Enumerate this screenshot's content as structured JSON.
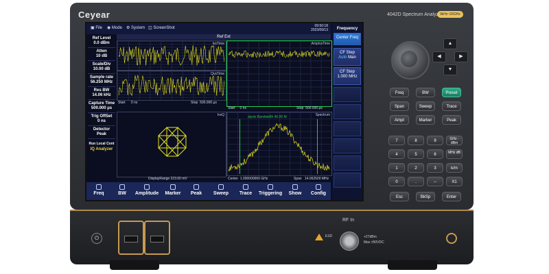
{
  "device": {
    "brand": "Ceyear",
    "model": "4042D Spectrum Analyzer",
    "model_badge": "9kHz~26GHz"
  },
  "menu": {
    "file": "File",
    "mode": "Mode",
    "system": "System",
    "screenshot": "ScreenShot",
    "time": "09:50:18",
    "date": "2023/09/13"
  },
  "params": {
    "ref_level_label": "Ref Level",
    "ref_level_value": "0.0 dBm",
    "atten_label": "Atten",
    "atten_value": "10 dB",
    "scale_label": "Scale/Div",
    "scale_value": "10.00 dB",
    "sample_rate_label": "Sample rate",
    "sample_rate_value": "56.250 MHz",
    "res_bw_label": "Res BW",
    "res_bw_value": "14.06 kHz",
    "capture_time_label": "Capture Time",
    "capture_time_value": "500.000 µs",
    "trig_offset_label": "Trig OffSet",
    "trig_offset_value": "0 ns",
    "detector_label": "Detector",
    "detector_value": "Peak",
    "run_local": "Run Local Cont",
    "mode_name": "IQ Analyzer"
  },
  "ref_ext": "Ref Ext",
  "charts": {
    "i_title": "IvsTime",
    "q_title": "QvsTime",
    "ampl_title": "AmplvsTime",
    "iq_title": "IvsQ",
    "spectrum_title": "Spectrum",
    "start_label": "Start",
    "start_value": "0 ns",
    "stop_label": "Stop",
    "stop_value": "500.000 µs",
    "start_label_2": "Start",
    "start_value_2": "0 ns",
    "stop_label_2": "Stop",
    "stop_value_2": "500.000 µs",
    "display_range": "DisplayRange 223.60 mV",
    "center_label": "Center",
    "center_value": "1.000000000 GHz",
    "span_label": "Span",
    "span_value": "14.062500 MHz",
    "analysis_bw": "alysis Bandwidth 40.00 M"
  },
  "softkeys": {
    "title": "Frequency",
    "center_freq": "Center Freq",
    "cf_step": "CF Step",
    "auto": "Auto",
    "man": "Man",
    "cf_step_2": "CF Step",
    "cf_step_value": "1.000 MHz"
  },
  "tabs": [
    "Freq",
    "BW",
    "Amplitude",
    "Marker",
    "Peak",
    "Sweep",
    "Trace",
    "Triggering",
    "Show",
    "Config"
  ],
  "hardkeys": {
    "row1": [
      "Freq",
      "BW",
      "Preset"
    ],
    "row2": [
      "Span",
      "Sweep",
      "Trace"
    ],
    "row3": [
      "Ampt",
      "Marker",
      "Peak"
    ],
    "num1": [
      "7",
      "8",
      "9",
      "GHz -dBm"
    ],
    "num2": [
      "4",
      "5",
      "6",
      "MHz dB"
    ],
    "num3": [
      "1",
      "2",
      "3",
      "k/m"
    ],
    "num4": [
      "0",
      ".",
      "–",
      "X1"
    ],
    "row_last": [
      "Esc",
      "BkSp",
      "Enter"
    ]
  },
  "panel": {
    "rf_in": "RF In",
    "spec1": "+27dBm",
    "spec2": "Max ±50VDC",
    "esd": "ESD"
  },
  "colors": {
    "accent": "#f4d33a",
    "trace_yellow": "#e8e21c",
    "active_tab": "#2e7ad8",
    "preset": "#2fa886",
    "brand_trim": "#c89a50"
  }
}
